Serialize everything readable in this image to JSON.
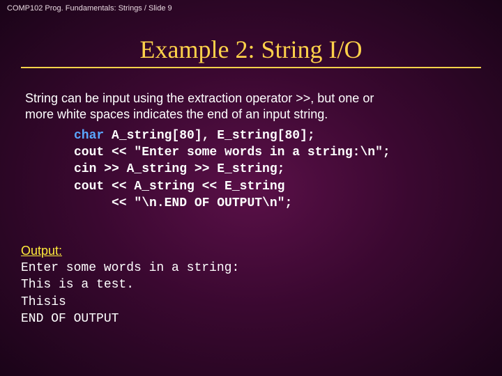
{
  "breadcrumb": "COMP102 Prog. Fundamentals: Strings / Slide 9",
  "title": "Example 2:  String I/O",
  "intro_line1": "String can be input using the extraction operator >>, but one or",
  "intro_line2": "more white spaces indicates the end of an input string.",
  "code": {
    "kw": "char",
    "line1_rest": " A_string[80], E_string[80];",
    "line2": "cout << \"Enter some words in a string:\\n\";",
    "line3": "cin >> A_string >> E_string;",
    "line4": "cout << A_string << E_string",
    "line5": "     << \"\\n.END OF OUTPUT\\n\";"
  },
  "output_label": "Output:",
  "output_lines": "Enter some words in a string:\nThis is a test.\nThisis\nEND OF OUTPUT"
}
